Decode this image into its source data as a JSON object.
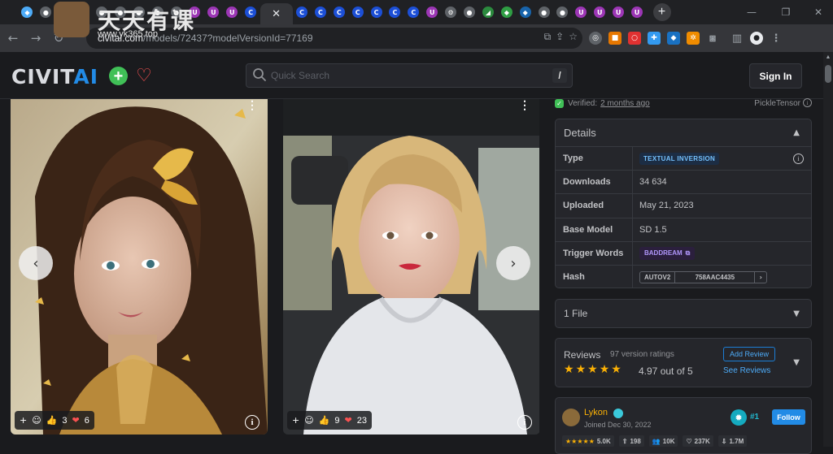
{
  "browser": {
    "tabs": [
      {
        "icon": "diamond-icon",
        "color": "#4dabf7",
        "glyph": "◆"
      },
      {
        "icon": "site-icon",
        "color": "#5f6368",
        "glyph": "●"
      },
      {
        "icon": "site-icon",
        "color": "#5f6368",
        "glyph": "●"
      },
      {
        "icon": "site-icon",
        "color": "#5f6368",
        "glyph": "●"
      },
      {
        "icon": "site-icon",
        "color": "#5f6368",
        "glyph": "●"
      },
      {
        "icon": "site-icon",
        "color": "#5f6368",
        "glyph": "●"
      },
      {
        "icon": "site-icon",
        "color": "#5f6368",
        "glyph": "●"
      },
      {
        "icon": "site-icon",
        "color": "#5f6368",
        "glyph": "●"
      },
      {
        "icon": "site-icon",
        "color": "#5f6368",
        "glyph": "●"
      },
      {
        "icon": "purple-u-icon",
        "color": "#9c36b5",
        "glyph": "U"
      },
      {
        "icon": "purple-u-icon",
        "color": "#9c36b5",
        "glyph": "U"
      },
      {
        "icon": "purple-u-icon",
        "color": "#9c36b5",
        "glyph": "U"
      },
      {
        "icon": "civitai-c-icon",
        "color": "#1c4fd6",
        "glyph": "C"
      }
    ],
    "active_tab_close": "✕",
    "tabs_after": [
      {
        "icon": "civitai-c-icon",
        "color": "#1c4fd6",
        "glyph": "C"
      },
      {
        "icon": "civitai-c-icon",
        "color": "#1c4fd6",
        "glyph": "C"
      },
      {
        "icon": "civitai-c-icon",
        "color": "#1c4fd6",
        "glyph": "C"
      },
      {
        "icon": "civitai-c-icon",
        "color": "#1c4fd6",
        "glyph": "C"
      },
      {
        "icon": "civitai-c-icon",
        "color": "#1c4fd6",
        "glyph": "C"
      },
      {
        "icon": "civitai-c-icon",
        "color": "#1c4fd6",
        "glyph": "C"
      },
      {
        "icon": "civitai-c-icon",
        "color": "#1c4fd6",
        "glyph": "C"
      },
      {
        "icon": "purple-u-icon",
        "color": "#9c36b5",
        "glyph": "U"
      },
      {
        "icon": "gear-icon",
        "color": "#5f6368",
        "glyph": "⚙"
      },
      {
        "icon": "site-icon",
        "color": "#5f6368",
        "glyph": "●"
      },
      {
        "icon": "nvidia-icon",
        "color": "#2b8a3e",
        "glyph": "◢"
      },
      {
        "icon": "flag-icon",
        "color": "#2f9e44",
        "glyph": "◆"
      },
      {
        "icon": "python-icon",
        "color": "#1864ab",
        "glyph": "◆"
      },
      {
        "icon": "site-icon",
        "color": "#5f6368",
        "glyph": "●"
      },
      {
        "icon": "site-icon",
        "color": "#5f6368",
        "glyph": "●"
      },
      {
        "icon": "purple-u-icon",
        "color": "#9c36b5",
        "glyph": "U"
      },
      {
        "icon": "purple-u-icon",
        "color": "#9c36b5",
        "glyph": "U"
      },
      {
        "icon": "purple-u-icon",
        "color": "#9c36b5",
        "glyph": "U"
      },
      {
        "icon": "purple-u-icon",
        "color": "#9c36b5",
        "glyph": "U"
      }
    ],
    "new_tab": "+",
    "url_host": "civitai.com",
    "url_path": "/models/72437?modelVersionId=77169",
    "window": {
      "minimize": "—",
      "restore": "❐",
      "close": "✕"
    }
  },
  "watermark": {
    "title": "天天有课",
    "subtitle": "www.yk365.top"
  },
  "header": {
    "logo_part1": "CIVIT",
    "logo_part2": "AI",
    "search_placeholder": "Quick Search",
    "search_shortcut": "/",
    "signin_label": "Sign In"
  },
  "gallery": {
    "cards": [
      {
        "reactions": {
          "add": "+",
          "smile": "☺",
          "like_emoji": "👍",
          "likes": "3",
          "heart_emoji": "❤",
          "hearts": "6"
        }
      },
      {
        "reactions": {
          "add": "+",
          "smile": "☺",
          "like_emoji": "👍",
          "likes": "9",
          "heart_emoji": "❤",
          "hearts": "23"
        }
      }
    ],
    "prev_glyph": "‹",
    "next_glyph": "›"
  },
  "sidebar": {
    "verified_label": "Verified:",
    "verified_when": "2 months ago",
    "author": "PickleTensor",
    "details_title": "Details",
    "details": [
      {
        "key": "Type",
        "value": "TEXTUAL INVERSION"
      },
      {
        "key": "Downloads",
        "value": "34 634"
      },
      {
        "key": "Uploaded",
        "value": "May 21, 2023"
      },
      {
        "key": "Base Model",
        "value": "SD 1.5"
      },
      {
        "key": "Trigger Words",
        "value": "BADDREAM"
      },
      {
        "key": "Hash",
        "hash_type": "AUTOV2",
        "hash_value": "758AAC4435"
      }
    ],
    "files_title": "1 File",
    "reviews": {
      "title": "Reviews",
      "count": "97 version ratings",
      "score": "4.97 out of 5",
      "add_review": "Add Review",
      "see_reviews": "See Reviews",
      "stars": 5
    },
    "creator": {
      "name": "Lykon",
      "joined": "Joined Dec 30, 2022",
      "rank": "#1",
      "follow": "Follow",
      "rating": "5.0K",
      "uploads": "198",
      "followers": "10K",
      "favorites": "237K",
      "downloads": "1.7M"
    }
  },
  "colors": {
    "accent": "#228be6",
    "success": "#40c057",
    "heart": "#fa5252",
    "star": "#fab005",
    "background": "#1a1b1e",
    "panel": "#25262b"
  }
}
